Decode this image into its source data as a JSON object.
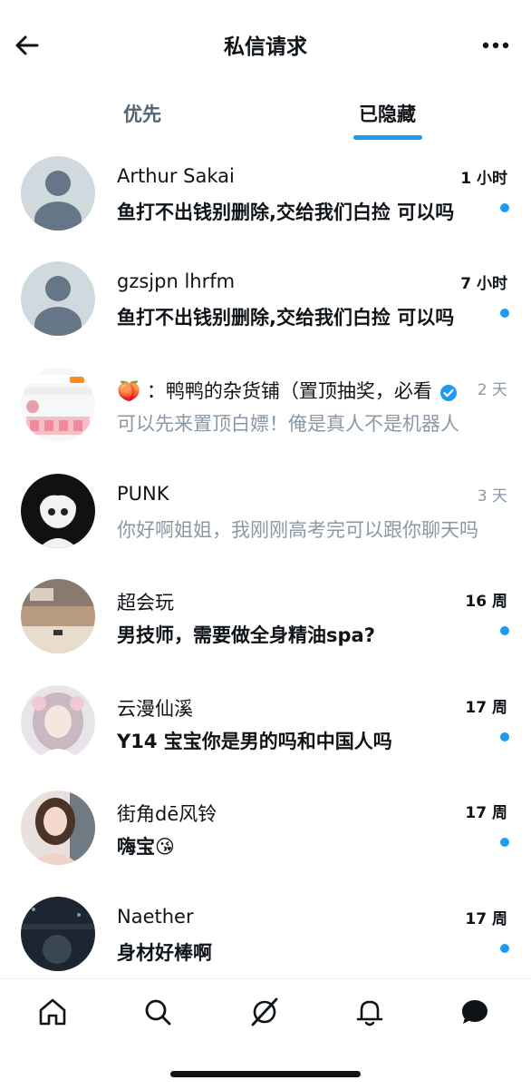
{
  "header": {
    "title": "私信请求",
    "back_icon": "arrow-left-icon",
    "more_icon": "more-horizontal-icon"
  },
  "tabs": [
    {
      "label": "优先",
      "active": false
    },
    {
      "label": "已隐藏",
      "active": true
    }
  ],
  "accent_color": "#1d9bf0",
  "conversations": [
    {
      "name": "Arthur Sakai",
      "time": "1 小时",
      "message": "鱼打不出钱别删除,交给我们白捡 可以吗",
      "unread": true,
      "verified": false
    },
    {
      "name": "gzsjpn lhrfm",
      "time": "7 小时",
      "message": "鱼打不出钱别删除,交给我们白捡 可以吗",
      "unread": true,
      "verified": false
    },
    {
      "name": "🍑 ：鸭鸭的杂货铺（置顶抽奖，必看",
      "time": "2 天",
      "message": "可以先来置顶白嫖！俺是真人不是机器人",
      "unread": false,
      "verified": true
    },
    {
      "name": "PUNK",
      "time": "3 天",
      "message": "你好啊姐姐，我刚刚高考完可以跟你聊天吗",
      "unread": false,
      "verified": false
    },
    {
      "name": "超会玩",
      "time": "16 周",
      "message": "男技师，需要做全身精油spa?",
      "unread": true,
      "verified": false
    },
    {
      "name": "云漫仙溪",
      "time": "17 周",
      "message": "Y14 宝宝你是男的吗和中国人吗",
      "unread": true,
      "verified": false
    },
    {
      "name": "街角dē风铃",
      "time": "17 周",
      "message": "嗨宝😘",
      "unread": true,
      "verified": false
    },
    {
      "name": "Naether",
      "time": "17 周",
      "message": "身材好棒啊",
      "unread": true,
      "verified": false
    }
  ],
  "bottom_nav": [
    "home-icon",
    "search-icon",
    "grok-icon",
    "bell-icon",
    "messages-icon"
  ]
}
